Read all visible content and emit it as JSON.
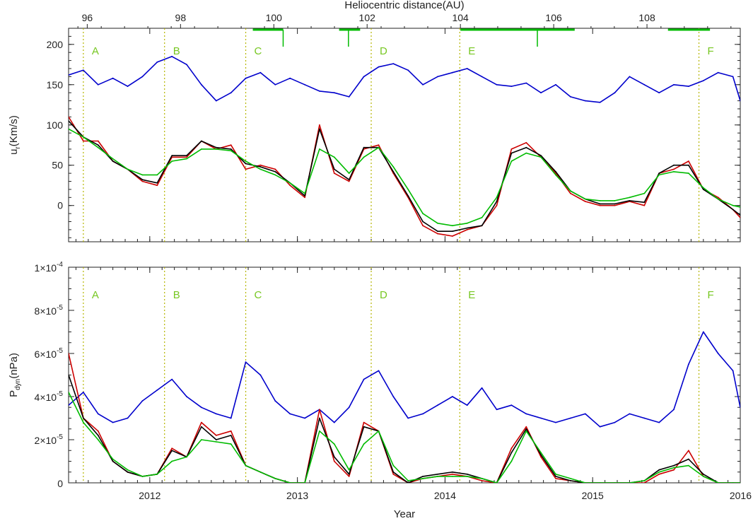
{
  "chart_data": [
    {
      "type": "line",
      "panel": "top",
      "top_axis_label": "Heliocentric distance(AU)",
      "top_axis_ticks": [
        "96",
        "98",
        "100",
        "102",
        "104",
        "106",
        "108"
      ],
      "top_axis_values": [
        96,
        98,
        100,
        102,
        104,
        106,
        108
      ],
      "top_axis_range": [
        95.6,
        110.0
      ],
      "ylabel": "u_r(Km/s)",
      "ylabel_main": "u",
      "ylabel_sub": "r",
      "ylabel_rest": "(Km/s)",
      "ylim": [
        -45,
        220
      ],
      "yticks": [
        "200",
        "150",
        "100",
        "50",
        "0"
      ],
      "ytick_values": [
        200,
        150,
        100,
        50,
        0
      ],
      "xlim": [
        2011.45,
        2016.0
      ],
      "markers": [
        {
          "label": "A",
          "x": 2011.55
        },
        {
          "label": "B",
          "x": 2012.1
        },
        {
          "label": "C",
          "x": 2012.65
        },
        {
          "label": "D",
          "x": 2013.5
        },
        {
          "label": "E",
          "x": 2014.1
        },
        {
          "label": "F",
          "x": 2015.72
        }
      ],
      "top_bars": [
        {
          "x": [
            99.55,
            100.2
          ],
          "tick": 100.2
        },
        {
          "x": [
            101.4,
            101.85
          ],
          "tick": 101.6
        },
        {
          "x": [
            104.0,
            106.45
          ],
          "tick": 105.65
        },
        {
          "x": [
            108.45,
            109.35
          ],
          "tick": null
        }
      ],
      "series": [
        {
          "color": "#0000cc",
          "x": [
            2011.45,
            2011.55,
            2011.65,
            2011.75,
            2011.85,
            2011.95,
            2012.05,
            2012.15,
            2012.25,
            2012.35,
            2012.45,
            2012.55,
            2012.65,
            2012.75,
            2012.85,
            2012.95,
            2013.05,
            2013.15,
            2013.25,
            2013.35,
            2013.45,
            2013.55,
            2013.65,
            2013.75,
            2013.85,
            2013.95,
            2014.05,
            2014.15,
            2014.25,
            2014.35,
            2014.45,
            2014.55,
            2014.65,
            2014.75,
            2014.85,
            2014.95,
            2015.05,
            2015.15,
            2015.25,
            2015.35,
            2015.45,
            2015.55,
            2015.65,
            2015.75,
            2015.85,
            2015.95,
            2016.0
          ],
          "values": [
            162,
            168,
            150,
            158,
            148,
            160,
            178,
            185,
            175,
            150,
            130,
            140,
            158,
            165,
            150,
            158,
            150,
            142,
            140,
            135,
            160,
            172,
            176,
            168,
            150,
            160,
            165,
            170,
            160,
            150,
            148,
            152,
            140,
            150,
            135,
            130,
            128,
            140,
            160,
            150,
            140,
            150,
            148,
            155,
            165,
            160,
            130
          ]
        },
        {
          "color": "#cc0000",
          "x": [
            2011.45,
            2011.55,
            2011.65,
            2011.75,
            2011.85,
            2011.95,
            2012.05,
            2012.15,
            2012.25,
            2012.35,
            2012.45,
            2012.55,
            2012.65,
            2012.75,
            2012.85,
            2012.95,
            2013.05,
            2013.15,
            2013.25,
            2013.35,
            2013.45,
            2013.55,
            2013.65,
            2013.75,
            2013.85,
            2013.95,
            2014.05,
            2014.15,
            2014.25,
            2014.35,
            2014.45,
            2014.55,
            2014.65,
            2014.75,
            2014.85,
            2014.95,
            2015.05,
            2015.15,
            2015.25,
            2015.35,
            2015.45,
            2015.55,
            2015.65,
            2015.75,
            2015.85,
            2015.95,
            2016.0
          ],
          "values": [
            110,
            80,
            80,
            55,
            45,
            30,
            25,
            60,
            60,
            80,
            70,
            75,
            45,
            50,
            45,
            25,
            10,
            100,
            40,
            30,
            70,
            75,
            40,
            10,
            -25,
            -35,
            -38,
            -30,
            -25,
            0,
            70,
            78,
            60,
            40,
            15,
            5,
            0,
            0,
            5,
            0,
            40,
            45,
            55,
            20,
            10,
            -5,
            -15
          ]
        },
        {
          "color": "#000000",
          "x": [
            2011.45,
            2011.55,
            2011.65,
            2011.75,
            2011.85,
            2011.95,
            2012.05,
            2012.15,
            2012.25,
            2012.35,
            2012.45,
            2012.55,
            2012.65,
            2012.75,
            2012.85,
            2012.95,
            2013.05,
            2013.15,
            2013.25,
            2013.35,
            2013.45,
            2013.55,
            2013.65,
            2013.75,
            2013.85,
            2013.95,
            2014.05,
            2014.15,
            2014.25,
            2014.35,
            2014.45,
            2014.55,
            2014.65,
            2014.75,
            2014.85,
            2014.95,
            2015.05,
            2015.15,
            2015.25,
            2015.35,
            2015.45,
            2015.55,
            2015.65,
            2015.75,
            2015.85,
            2015.95,
            2016.0
          ],
          "values": [
            105,
            85,
            75,
            55,
            45,
            32,
            28,
            62,
            62,
            80,
            72,
            70,
            52,
            48,
            42,
            28,
            12,
            95,
            45,
            32,
            72,
            72,
            42,
            12,
            -20,
            -32,
            -32,
            -28,
            -25,
            5,
            65,
            72,
            62,
            42,
            18,
            8,
            2,
            2,
            6,
            4,
            40,
            50,
            50,
            20,
            8,
            -5,
            -12
          ]
        },
        {
          "color": "#00bb00",
          "x": [
            2011.45,
            2011.55,
            2011.65,
            2011.75,
            2011.85,
            2011.95,
            2012.05,
            2012.15,
            2012.25,
            2012.35,
            2012.45,
            2012.55,
            2012.65,
            2012.75,
            2012.85,
            2012.95,
            2013.05,
            2013.15,
            2013.25,
            2013.35,
            2013.45,
            2013.55,
            2013.65,
            2013.75,
            2013.85,
            2013.95,
            2014.05,
            2014.15,
            2014.25,
            2014.35,
            2014.45,
            2014.55,
            2014.65,
            2014.75,
            2014.85,
            2014.95,
            2015.05,
            2015.15,
            2015.25,
            2015.35,
            2015.45,
            2015.55,
            2015.65,
            2015.75,
            2015.85,
            2015.95,
            2016.0
          ],
          "values": [
            95,
            85,
            72,
            58,
            45,
            38,
            38,
            55,
            58,
            70,
            70,
            68,
            55,
            45,
            38,
            28,
            15,
            70,
            60,
            40,
            60,
            72,
            48,
            20,
            -10,
            -22,
            -25,
            -22,
            -15,
            10,
            55,
            65,
            60,
            38,
            18,
            8,
            6,
            6,
            10,
            15,
            38,
            42,
            40,
            22,
            8,
            0,
            -2
          ]
        }
      ]
    },
    {
      "type": "line",
      "panel": "bottom",
      "xlabel": "Year",
      "xticks": [
        "2012",
        "2013",
        "2014",
        "2015",
        "2016"
      ],
      "xtick_values": [
        2012,
        2013,
        2014,
        2015,
        2016
      ],
      "xlim": [
        2011.45,
        2016.0
      ],
      "ylabel": "P_dyn(nPa)",
      "ylabel_main": "P",
      "ylabel_sub": "dyn",
      "ylabel_rest": "(nPa)",
      "ylim": [
        0,
        0.0001
      ],
      "ytick_values": [
        0.0001,
        8e-05,
        6e-05,
        4e-05,
        2e-05,
        0
      ],
      "ytick_labels": [
        {
          "mantissa": "1×10",
          "exp": "-4"
        },
        {
          "mantissa": "8×10",
          "exp": "-5"
        },
        {
          "mantissa": "6×10",
          "exp": "-5"
        },
        {
          "mantissa": "4×10",
          "exp": "-5"
        },
        {
          "mantissa": "2×10",
          "exp": "-5"
        },
        {
          "mantissa": "0",
          "exp": ""
        }
      ],
      "markers": [
        {
          "label": "A",
          "x": 2011.55
        },
        {
          "label": "B",
          "x": 2012.1
        },
        {
          "label": "C",
          "x": 2012.65
        },
        {
          "label": "D",
          "x": 2013.5
        },
        {
          "label": "E",
          "x": 2014.1
        },
        {
          "label": "F",
          "x": 2015.72
        }
      ],
      "series": [
        {
          "color": "#0000cc",
          "x": [
            2011.45,
            2011.55,
            2011.65,
            2011.75,
            2011.85,
            2011.95,
            2012.05,
            2012.15,
            2012.25,
            2012.35,
            2012.45,
            2012.55,
            2012.65,
            2012.75,
            2012.85,
            2012.95,
            2013.05,
            2013.15,
            2013.25,
            2013.35,
            2013.45,
            2013.55,
            2013.65,
            2013.75,
            2013.85,
            2013.95,
            2014.05,
            2014.15,
            2014.25,
            2014.35,
            2014.45,
            2014.55,
            2014.65,
            2014.75,
            2014.85,
            2014.95,
            2015.05,
            2015.15,
            2015.25,
            2015.35,
            2015.45,
            2015.55,
            2015.65,
            2015.75,
            2015.85,
            2015.95,
            2016.0
          ],
          "values": [
            3.6e-05,
            4.2e-05,
            3.2e-05,
            2.8e-05,
            3e-05,
            3.8e-05,
            4.3e-05,
            4.8e-05,
            4e-05,
            3.5e-05,
            3.2e-05,
            3e-05,
            5.6e-05,
            5e-05,
            3.8e-05,
            3.2e-05,
            3e-05,
            3.4e-05,
            2.8e-05,
            3.5e-05,
            4.8e-05,
            5.2e-05,
            4e-05,
            3e-05,
            3.2e-05,
            3.6e-05,
            4e-05,
            3.6e-05,
            4.4e-05,
            3.4e-05,
            3.6e-05,
            3.2e-05,
            3e-05,
            2.8e-05,
            3e-05,
            3.2e-05,
            2.6e-05,
            2.8e-05,
            3.2e-05,
            3e-05,
            2.8e-05,
            3.4e-05,
            5.5e-05,
            7e-05,
            6e-05,
            5.2e-05,
            3.5e-05
          ]
        },
        {
          "color": "#cc0000",
          "x": [
            2011.45,
            2011.55,
            2011.65,
            2011.75,
            2011.85,
            2011.95,
            2012.05,
            2012.15,
            2012.25,
            2012.35,
            2012.45,
            2012.55,
            2012.65,
            2012.75,
            2012.85,
            2012.95,
            2013.05,
            2013.15,
            2013.25,
            2013.35,
            2013.45,
            2013.55,
            2013.65,
            2013.75,
            2013.85,
            2013.95,
            2014.05,
            2014.15,
            2014.25,
            2014.35,
            2014.45,
            2014.55,
            2014.65,
            2014.75,
            2014.85,
            2014.95,
            2015.05,
            2015.15,
            2015.25,
            2015.35,
            2015.45,
            2015.55,
            2015.65,
            2015.75,
            2015.85,
            2015.95,
            2016.0
          ],
          "values": [
            6e-05,
            3e-05,
            2.4e-05,
            1e-05,
            5e-06,
            3e-06,
            4e-06,
            1.6e-05,
            1.2e-05,
            2.8e-05,
            2.2e-05,
            2.4e-05,
            8e-06,
            5e-06,
            2e-06,
            0,
            0,
            3.4e-05,
            1e-05,
            3e-06,
            2.8e-05,
            2.4e-05,
            4e-06,
            0,
            2e-06,
            3e-06,
            4e-06,
            3e-06,
            1e-06,
            0,
            1.6e-05,
            2.6e-05,
            1.2e-05,
            2e-06,
            1e-06,
            0,
            0,
            0,
            0,
            0,
            4e-06,
            6e-06,
            1.5e-05,
            3e-06,
            0,
            0,
            0
          ]
        },
        {
          "color": "#000000",
          "x": [
            2011.45,
            2011.55,
            2011.65,
            2011.75,
            2011.85,
            2011.95,
            2012.05,
            2012.15,
            2012.25,
            2012.35,
            2012.45,
            2012.55,
            2012.65,
            2012.75,
            2012.85,
            2012.95,
            2013.05,
            2013.15,
            2013.25,
            2013.35,
            2013.45,
            2013.55,
            2013.65,
            2013.75,
            2013.85,
            2013.95,
            2014.05,
            2014.15,
            2014.25,
            2014.35,
            2014.45,
            2014.55,
            2014.65,
            2014.75,
            2014.85,
            2014.95,
            2015.05,
            2015.15,
            2015.25,
            2015.35,
            2015.45,
            2015.55,
            2015.65,
            2015.75,
            2015.85,
            2015.95,
            2016.0
          ],
          "values": [
            5e-05,
            3e-05,
            2.2e-05,
            1e-05,
            5e-06,
            3e-06,
            4e-06,
            1.5e-05,
            1.2e-05,
            2.6e-05,
            2e-05,
            2.2e-05,
            8e-06,
            5e-06,
            2e-06,
            0,
            0,
            3e-05,
            1.2e-05,
            4e-06,
            2.6e-05,
            2.4e-05,
            5e-06,
            0,
            3e-06,
            4e-06,
            5e-06,
            4e-06,
            2e-06,
            0,
            1.4e-05,
            2.5e-05,
            1.3e-05,
            3e-06,
            1e-06,
            0,
            0,
            0,
            0,
            1e-06,
            6e-06,
            8e-06,
            1.1e-05,
            4e-06,
            0,
            0,
            0
          ]
        },
        {
          "color": "#00bb00",
          "x": [
            2011.45,
            2011.55,
            2011.65,
            2011.75,
            2011.85,
            2011.95,
            2012.05,
            2012.15,
            2012.25,
            2012.35,
            2012.45,
            2012.55,
            2012.65,
            2012.75,
            2012.85,
            2012.95,
            2013.05,
            2013.15,
            2013.25,
            2013.35,
            2013.45,
            2013.55,
            2013.65,
            2013.75,
            2013.85,
            2013.95,
            2014.05,
            2014.15,
            2014.25,
            2014.35,
            2014.45,
            2014.55,
            2014.65,
            2014.75,
            2014.85,
            2014.95,
            2015.05,
            2015.15,
            2015.25,
            2015.35,
            2015.45,
            2015.55,
            2015.65,
            2015.75,
            2015.85,
            2015.95,
            2016.0
          ],
          "values": [
            4.2e-05,
            2.8e-05,
            2e-05,
            1.1e-05,
            6e-06,
            3e-06,
            4e-06,
            1e-05,
            1.2e-05,
            2e-05,
            1.9e-05,
            1.8e-05,
            8e-06,
            5e-06,
            2e-06,
            0,
            0,
            2.4e-05,
            1.8e-05,
            6e-06,
            1.8e-05,
            2.4e-05,
            8e-06,
            1e-06,
            2e-06,
            3e-06,
            3e-06,
            3e-06,
            2e-06,
            0,
            1e-05,
            2.4e-05,
            1.4e-05,
            4e-06,
            2e-06,
            0,
            0,
            0,
            0,
            1e-06,
            5e-06,
            7e-06,
            8e-06,
            3e-06,
            0,
            0,
            0
          ]
        }
      ]
    }
  ]
}
